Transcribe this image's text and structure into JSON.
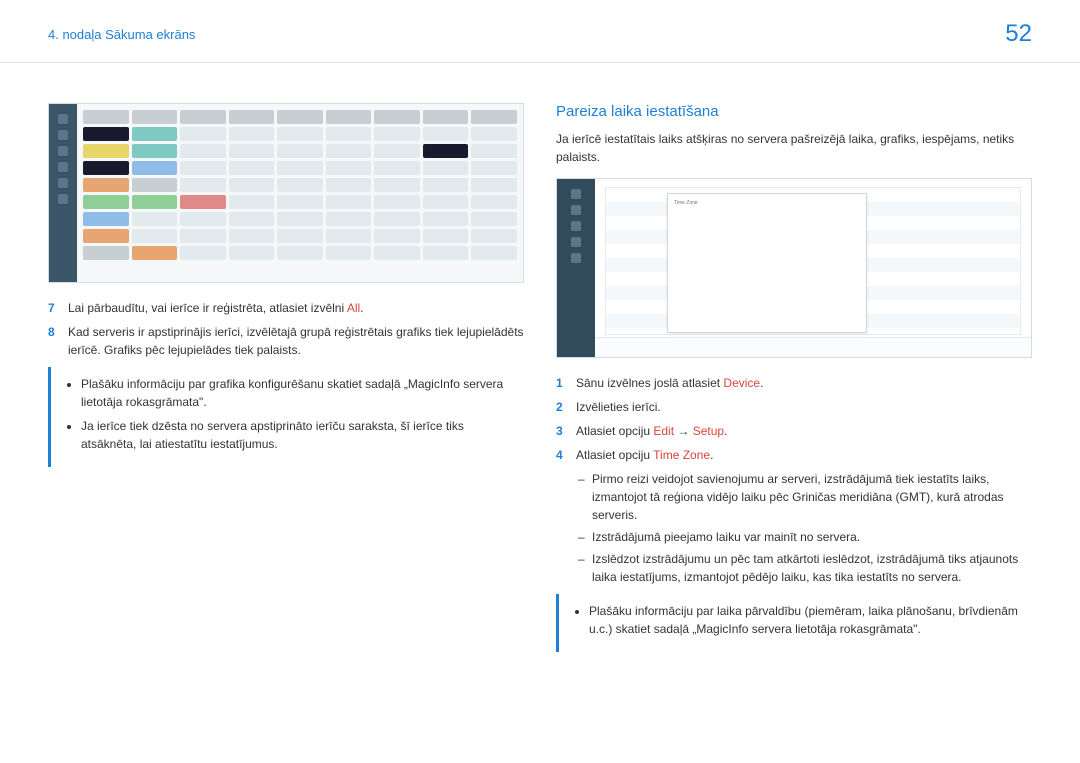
{
  "header": {
    "chapter": "4. nodaļa Sākuma ekrāns",
    "page_number": "52"
  },
  "left": {
    "step7_num": "7",
    "step7_text_a": "Lai pārbaudītu, vai ierīce ir reģistrēta, atlasiet izvēlni ",
    "step7_highlight": "All",
    "step7_text_b": ".",
    "step8_num": "8",
    "step8_text": "Kad serveris ir apstiprinājis ierīci, izvēlētajā grupā reģistrētais grafiks tiek lejupielādēts ierīcē. Grafiks pēc lejupielādes tiek palaists.",
    "callout_1": "Plašāku informāciju par grafika konfigurēšanu skatiet sadaļā „MagicInfo servera lietotāja rokasgrāmata\".",
    "callout_2": "Ja ierīce tiek dzēsta no servera apstiprināto ierīču saraksta, šī ierīce tiks atsāknēta, lai atiestatītu iestatījumus."
  },
  "right": {
    "heading": "Pareiza laika iestatīšana",
    "intro": "Ja ierīcē iestatītais laiks atšķiras no servera pašreizējā laika, grafiks, iespējams, netiks palaists.",
    "step1_num": "1",
    "step1_text_a": "Sānu izvēlnes joslā atlasiet ",
    "step1_highlight": "Device",
    "step1_text_b": ".",
    "step2_num": "2",
    "step2_text": "Izvēlieties ierīci.",
    "step3_num": "3",
    "step3_text_a": "Atlasiet opciju ",
    "step3_edit": "Edit",
    "step3_arrow": " → ",
    "step3_setup": "Setup",
    "step3_text_b": ".",
    "step4_num": "4",
    "step4_text_a": "Atlasiet opciju ",
    "step4_highlight": "Time Zone",
    "step4_text_b": ".",
    "sub1": "Pirmo reizi veidojot savienojumu ar serveri, izstrādājumā tiek iestatīts laiks, izmantojot tā reģiona vidējo laiku pēc Griničas meridiāna (GMT), kurā atrodas serveris.",
    "sub2": "Izstrādājumā pieejamo laiku var mainīt no servera.",
    "sub3": "Izslēdzot izstrādājumu un pēc tam atkārtoti ieslēdzot, izstrādājumā tiks atjaunots laika iestatījums, izmantojot pēdējo laiku, kas tika iestatīts no servera.",
    "callout": "Plašāku informāciju par laika pārvaldību (piemēram, laika plānošanu, brīvdienām u.c.) skatiet sadaļā „MagicInfo servera lietotāja rokasgrāmata\"."
  }
}
